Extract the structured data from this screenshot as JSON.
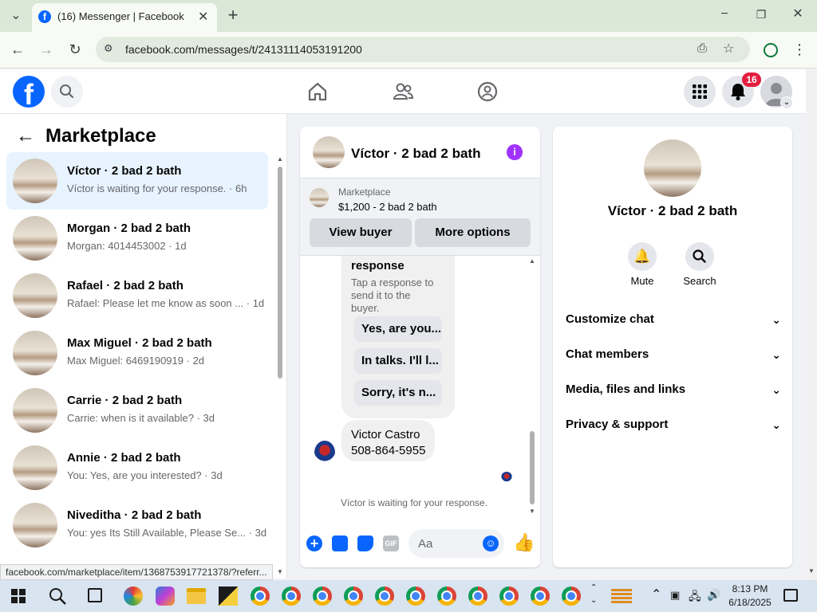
{
  "browser": {
    "tab_title": "(16) Messenger | Facebook",
    "url": "facebook.com/messages/t/24131114053191200"
  },
  "header": {
    "notification_count": "16"
  },
  "left": {
    "title": "Marketplace",
    "conversations": [
      {
        "title": "Víctor · 2 bad 2 bath",
        "preview": "Víctor is waiting for your response.",
        "time": "6h"
      },
      {
        "title": "Morgan · 2 bad 2 bath",
        "preview": "Morgan: 4014453002",
        "time": "1d"
      },
      {
        "title": "Rafael · 2 bad 2 bath",
        "preview": "Rafael: Please let me know as soon ...",
        "time": "1d"
      },
      {
        "title": "Max Miguel · 2 bad 2 bath",
        "preview": "Max Miguel: 6469190919",
        "time": "2d"
      },
      {
        "title": "Carrie · 2 bad 2 bath",
        "preview": "Carrie: when is it available?",
        "time": "3d"
      },
      {
        "title": "Annie · 2 bad 2 bath",
        "preview": "You: Yes, are you interested?",
        "time": "3d"
      },
      {
        "title": "Niveditha · 2 bad 2 bath",
        "preview": "You: yes Its Still Available, Please Se...",
        "time": "3d"
      }
    ]
  },
  "chat": {
    "title": "Víctor · 2 bad 2 bath",
    "market_label": "Marketplace",
    "listing": "$1,200 - 2 bad 2 bath",
    "view_buyer": "View buyer",
    "more_options": "More options",
    "bubble_heading": "response",
    "bubble_hint": "Tap a response to send it to the buyer.",
    "quick_replies": [
      "Yes, are you...",
      "In talks. I'll l...",
      "Sorry, it's n..."
    ],
    "message_name": "Victor Castro",
    "message_phone": "508-864-5955",
    "waiting": "Víctor is waiting for your response.",
    "input_placeholder": "Aa"
  },
  "right": {
    "name": "Víctor · 2 bad 2 bath",
    "mute": "Mute",
    "search": "Search",
    "rows": [
      "Customize chat",
      "Chat members",
      "Media, files and links",
      "Privacy & support"
    ]
  },
  "status_url": "facebook.com/marketplace/item/1368753917721378/?referr...",
  "taskbar": {
    "time": "8:13 PM",
    "date": "6/18/2025"
  },
  "colors": {
    "facebook_blue": "#0866ff",
    "messenger_purple": "#a033ff",
    "badge_red": "#e41e3f"
  }
}
